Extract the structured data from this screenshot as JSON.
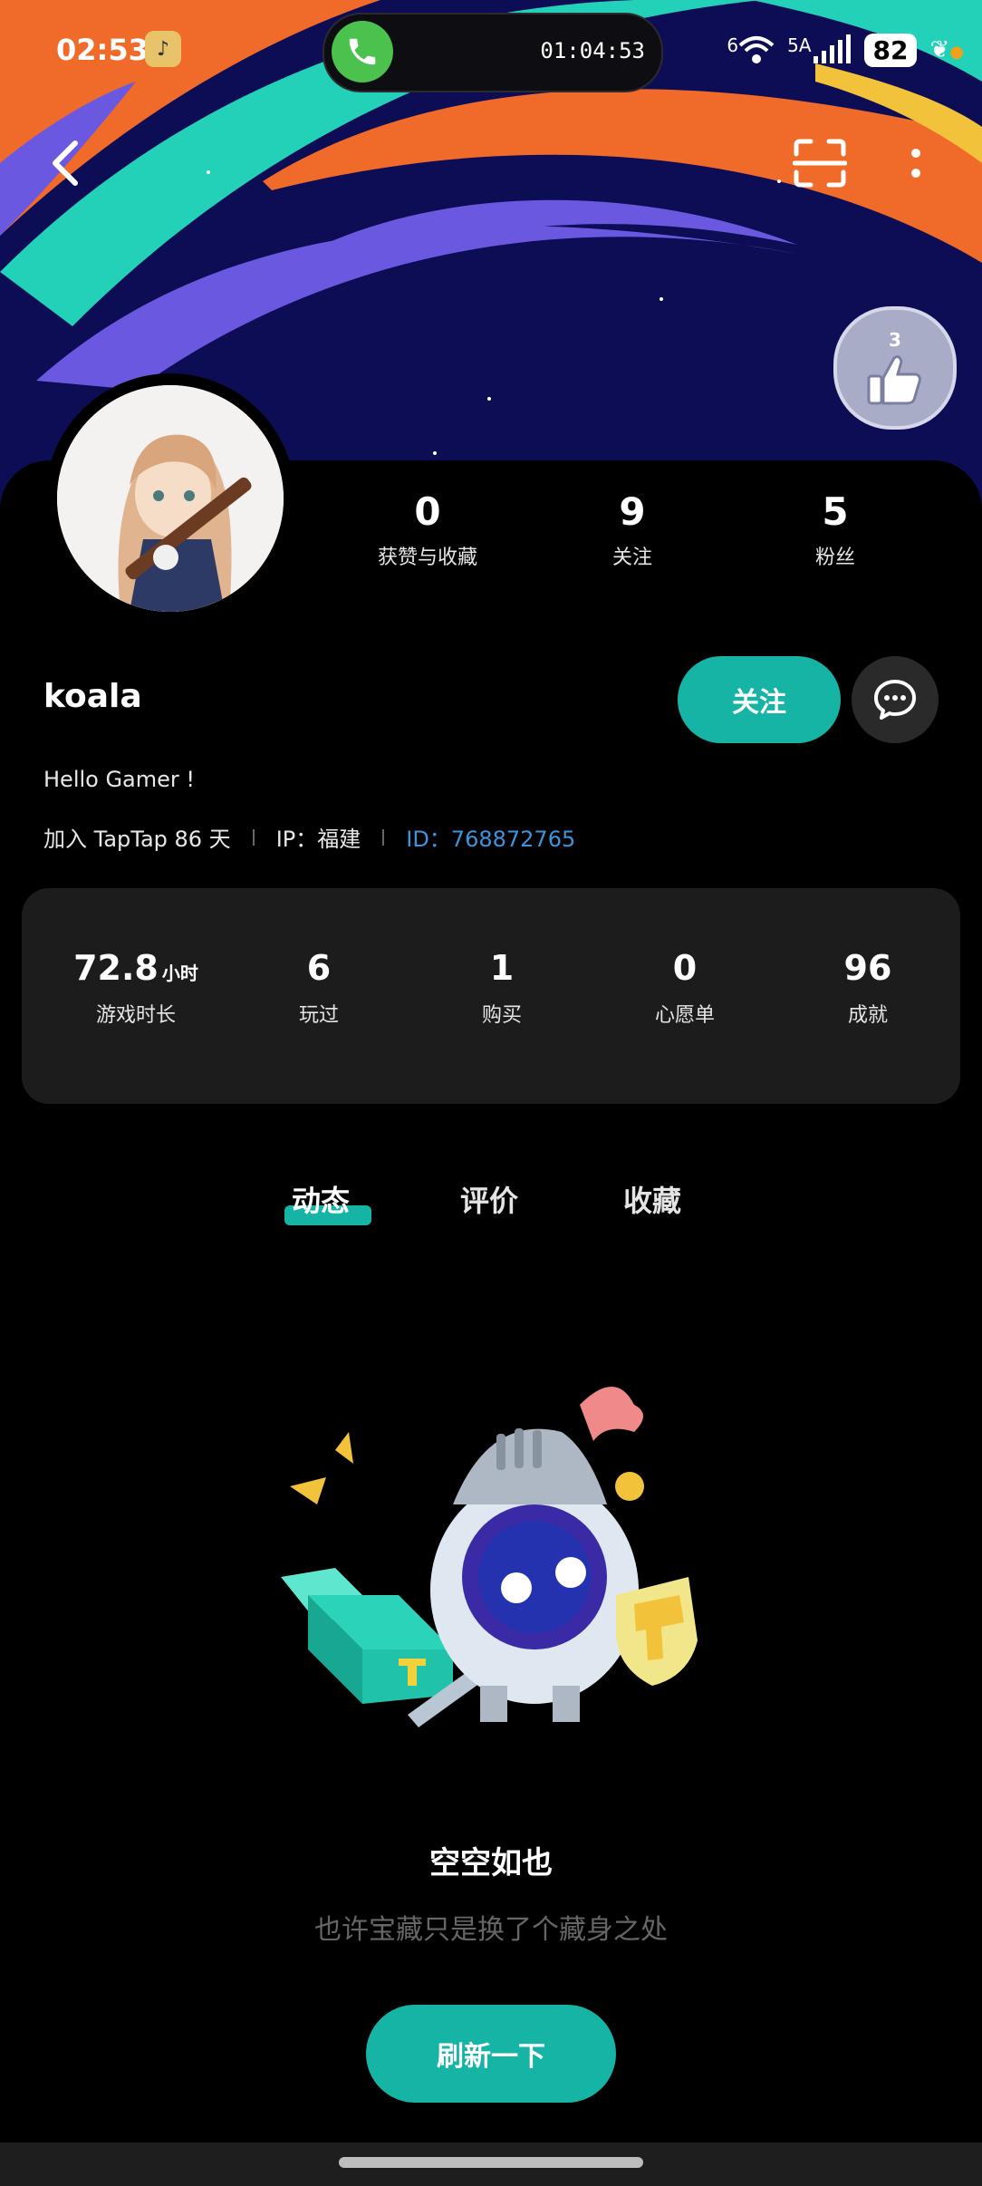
{
  "status_bar": {
    "time": "02:53",
    "call_duration": "01:04:53",
    "battery": "82",
    "network_label": "6",
    "signal_label": "5A"
  },
  "header": {
    "back_icon": "chevron-left-icon",
    "scan_icon": "scan-icon",
    "more_icon": "more-vertical-icon",
    "badge_number": "3"
  },
  "profile": {
    "username": "koala",
    "bio": "Hello Gamer !",
    "joined": "加入 TapTap 86 天",
    "ip": "IP：福建",
    "id": "ID：768872765",
    "follow_label": "关注",
    "stats": [
      {
        "value": "0",
        "label": "获赞与收藏"
      },
      {
        "value": "9",
        "label": "关注"
      },
      {
        "value": "5",
        "label": "粉丝"
      }
    ]
  },
  "game_stats": [
    {
      "value": "72.8",
      "unit": "小时",
      "label": "游戏时长"
    },
    {
      "value": "6",
      "unit": "",
      "label": "玩过"
    },
    {
      "value": "1",
      "unit": "",
      "label": "购买"
    },
    {
      "value": "0",
      "unit": "",
      "label": "心愿单"
    },
    {
      "value": "96",
      "unit": "",
      "label": "成就"
    }
  ],
  "tabs": [
    {
      "label": "动态",
      "active": true
    },
    {
      "label": "评价",
      "active": false
    },
    {
      "label": "收藏",
      "active": false
    }
  ],
  "empty_state": {
    "title": "空空如也",
    "subtitle": "也许宝藏只是换了个藏身之处",
    "button": "刷新一下"
  },
  "colors": {
    "accent": "#15b4a4",
    "id_link": "#3e93d9",
    "card_bg": "#1c1c1c"
  }
}
